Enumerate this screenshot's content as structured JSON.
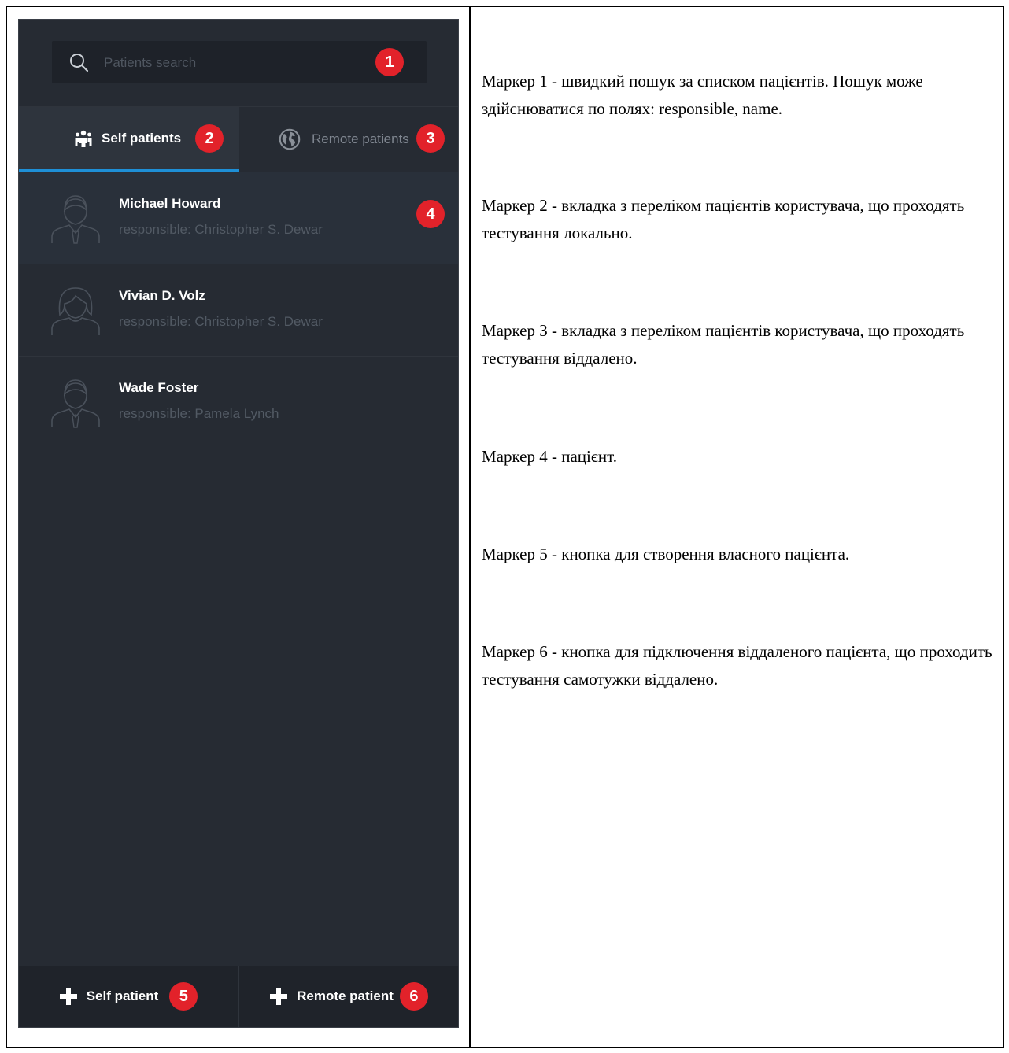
{
  "search": {
    "placeholder": "Patients search"
  },
  "tabs": [
    {
      "label": "Self patients",
      "icon": "group-icon",
      "active": true
    },
    {
      "label": "Remote patients",
      "icon": "globe-icon",
      "active": false
    }
  ],
  "patients": [
    {
      "name": "Michael Howard",
      "responsible": "responsible: Christopher S. Dewar",
      "avatar": "male-avatar-icon"
    },
    {
      "name": "Vivian D. Volz",
      "responsible": "responsible: Christopher S. Dewar",
      "avatar": "female-avatar-icon"
    },
    {
      "name": "Wade Foster",
      "responsible": "responsible: Pamela Lynch",
      "avatar": "male-avatar-icon"
    }
  ],
  "footer": {
    "self_label": "Self patient",
    "remote_label": "Remote patient"
  },
  "markers": [
    "1",
    "2",
    "3",
    "4",
    "5",
    "6"
  ],
  "descriptions": [
    "Маркер 1 - швидкий пошук за списком пацієнтів. Пошук може здійснюватися по полях: responsible, name.",
    "Маркер 2 - вкладка з переліком пацієнтів користувача, що проходять тестування локально.",
    "Маркер 3 - вкладка з переліком пацієнтів користувача, що проходять тестування віддалено.",
    "Маркер 4 - пацієнт.",
    "Маркер 5 - кнопка для створення власного пацієнта.",
    "Маркер 6 - кнопка для підключення віддаленого пацієнта, що проходить тестування самотужки віддалено."
  ],
  "colors": {
    "panel_bg": "#262b33",
    "accent": "#1e8fd6",
    "marker": "#e2222a"
  }
}
